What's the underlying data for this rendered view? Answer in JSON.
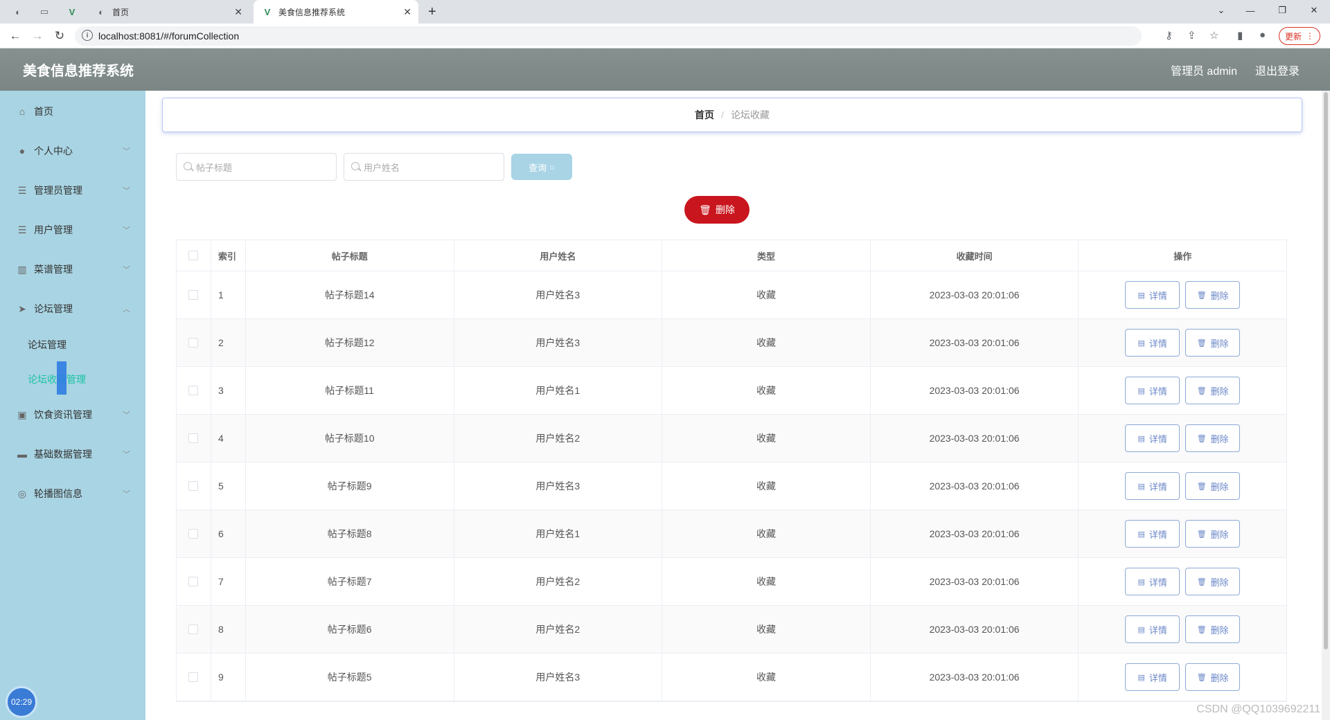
{
  "browser": {
    "tabs": [
      {
        "label": "首页"
      },
      {
        "label": "美食信息推荐系统"
      }
    ],
    "url": "localhost:8081/#/forumCollection",
    "update_label": "更新"
  },
  "header": {
    "app_title": "美食信息推荐系统",
    "user_label": "管理员 admin",
    "logout_label": "退出登录"
  },
  "sidebar": {
    "items": [
      {
        "label": "首页",
        "icon": "home-icon"
      },
      {
        "label": "个人中心",
        "icon": "user-icon"
      },
      {
        "label": "管理员管理",
        "icon": "list-icon"
      },
      {
        "label": "用户管理",
        "icon": "list-icon"
      },
      {
        "label": "菜谱管理",
        "icon": "chart-icon"
      },
      {
        "label": "论坛管理",
        "icon": "send-icon"
      },
      {
        "label": "饮食资讯管理",
        "icon": "briefcase-icon"
      },
      {
        "label": "基础数据管理",
        "icon": "tablet-icon"
      },
      {
        "label": "轮播图信息",
        "icon": "compass-icon"
      }
    ],
    "sub_items": [
      {
        "label": "论坛管理"
      },
      {
        "label": "论坛收藏管理"
      }
    ],
    "clock": "02:29"
  },
  "breadcrumb": {
    "home": "首页",
    "separator": "/",
    "current": "论坛收藏"
  },
  "search": {
    "title_placeholder": "帖子标题",
    "user_placeholder": "用户姓名",
    "query_label": "查询"
  },
  "toolbar": {
    "delete_label": "删除"
  },
  "table": {
    "columns": [
      "索引",
      "帖子标题",
      "用户姓名",
      "类型",
      "收藏时间",
      "操作"
    ],
    "detail_label": "详情",
    "delete_label": "删除",
    "rows": [
      {
        "index": "1",
        "title": "帖子标题14",
        "user": "用户姓名3",
        "type": "收藏",
        "time": "2023-03-03 20:01:06"
      },
      {
        "index": "2",
        "title": "帖子标题12",
        "user": "用户姓名3",
        "type": "收藏",
        "time": "2023-03-03 20:01:06"
      },
      {
        "index": "3",
        "title": "帖子标题11",
        "user": "用户姓名1",
        "type": "收藏",
        "time": "2023-03-03 20:01:06"
      },
      {
        "index": "4",
        "title": "帖子标题10",
        "user": "用户姓名2",
        "type": "收藏",
        "time": "2023-03-03 20:01:06"
      },
      {
        "index": "5",
        "title": "帖子标题9",
        "user": "用户姓名3",
        "type": "收藏",
        "time": "2023-03-03 20:01:06"
      },
      {
        "index": "6",
        "title": "帖子标题8",
        "user": "用户姓名1",
        "type": "收藏",
        "time": "2023-03-03 20:01:06"
      },
      {
        "index": "7",
        "title": "帖子标题7",
        "user": "用户姓名2",
        "type": "收藏",
        "time": "2023-03-03 20:01:06"
      },
      {
        "index": "8",
        "title": "帖子标题6",
        "user": "用户姓名2",
        "type": "收藏",
        "time": "2023-03-03 20:01:06"
      },
      {
        "index": "9",
        "title": "帖子标题5",
        "user": "用户姓名3",
        "type": "收藏",
        "time": "2023-03-03 20:01:06"
      }
    ]
  },
  "watermark": "CSDN @QQ1039692211"
}
